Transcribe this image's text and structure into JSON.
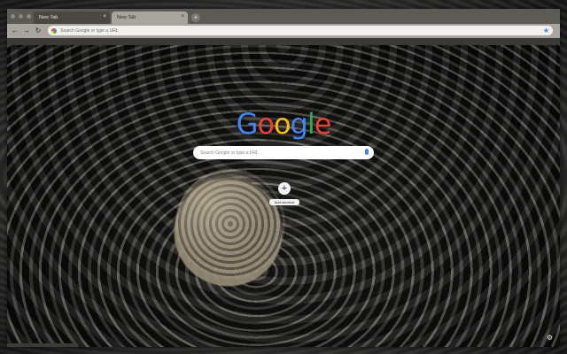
{
  "tabs": [
    {
      "label": "New Tab"
    },
    {
      "label": "New Tab"
    }
  ],
  "tab_close": "×",
  "new_tab_symbol": "+",
  "nav": {
    "back": "←",
    "forward": "→",
    "reload": "↻"
  },
  "omnibox": {
    "placeholder": "Search Google or type a URL",
    "star": "★"
  },
  "logo": {
    "g1": "G",
    "o1": "o",
    "o2": "o",
    "g2": "g",
    "l": "l",
    "e": "e"
  },
  "search": {
    "placeholder": "Search Google or type a URL"
  },
  "shortcut": {
    "symbol": "+",
    "label": "Add shortcut"
  },
  "customize": {
    "symbol": "⚙"
  },
  "colors": {
    "google_blue": "#4285f4",
    "google_red": "#ea4335",
    "google_yellow": "#fbbc05",
    "google_green": "#34a853",
    "frame": "#5c5a55",
    "toolbar": "#a8a59e"
  },
  "icons": [
    "back-icon",
    "forward-icon",
    "reload-icon",
    "google-g-icon",
    "star-icon",
    "mic-icon",
    "plus-icon",
    "gear-icon"
  ]
}
